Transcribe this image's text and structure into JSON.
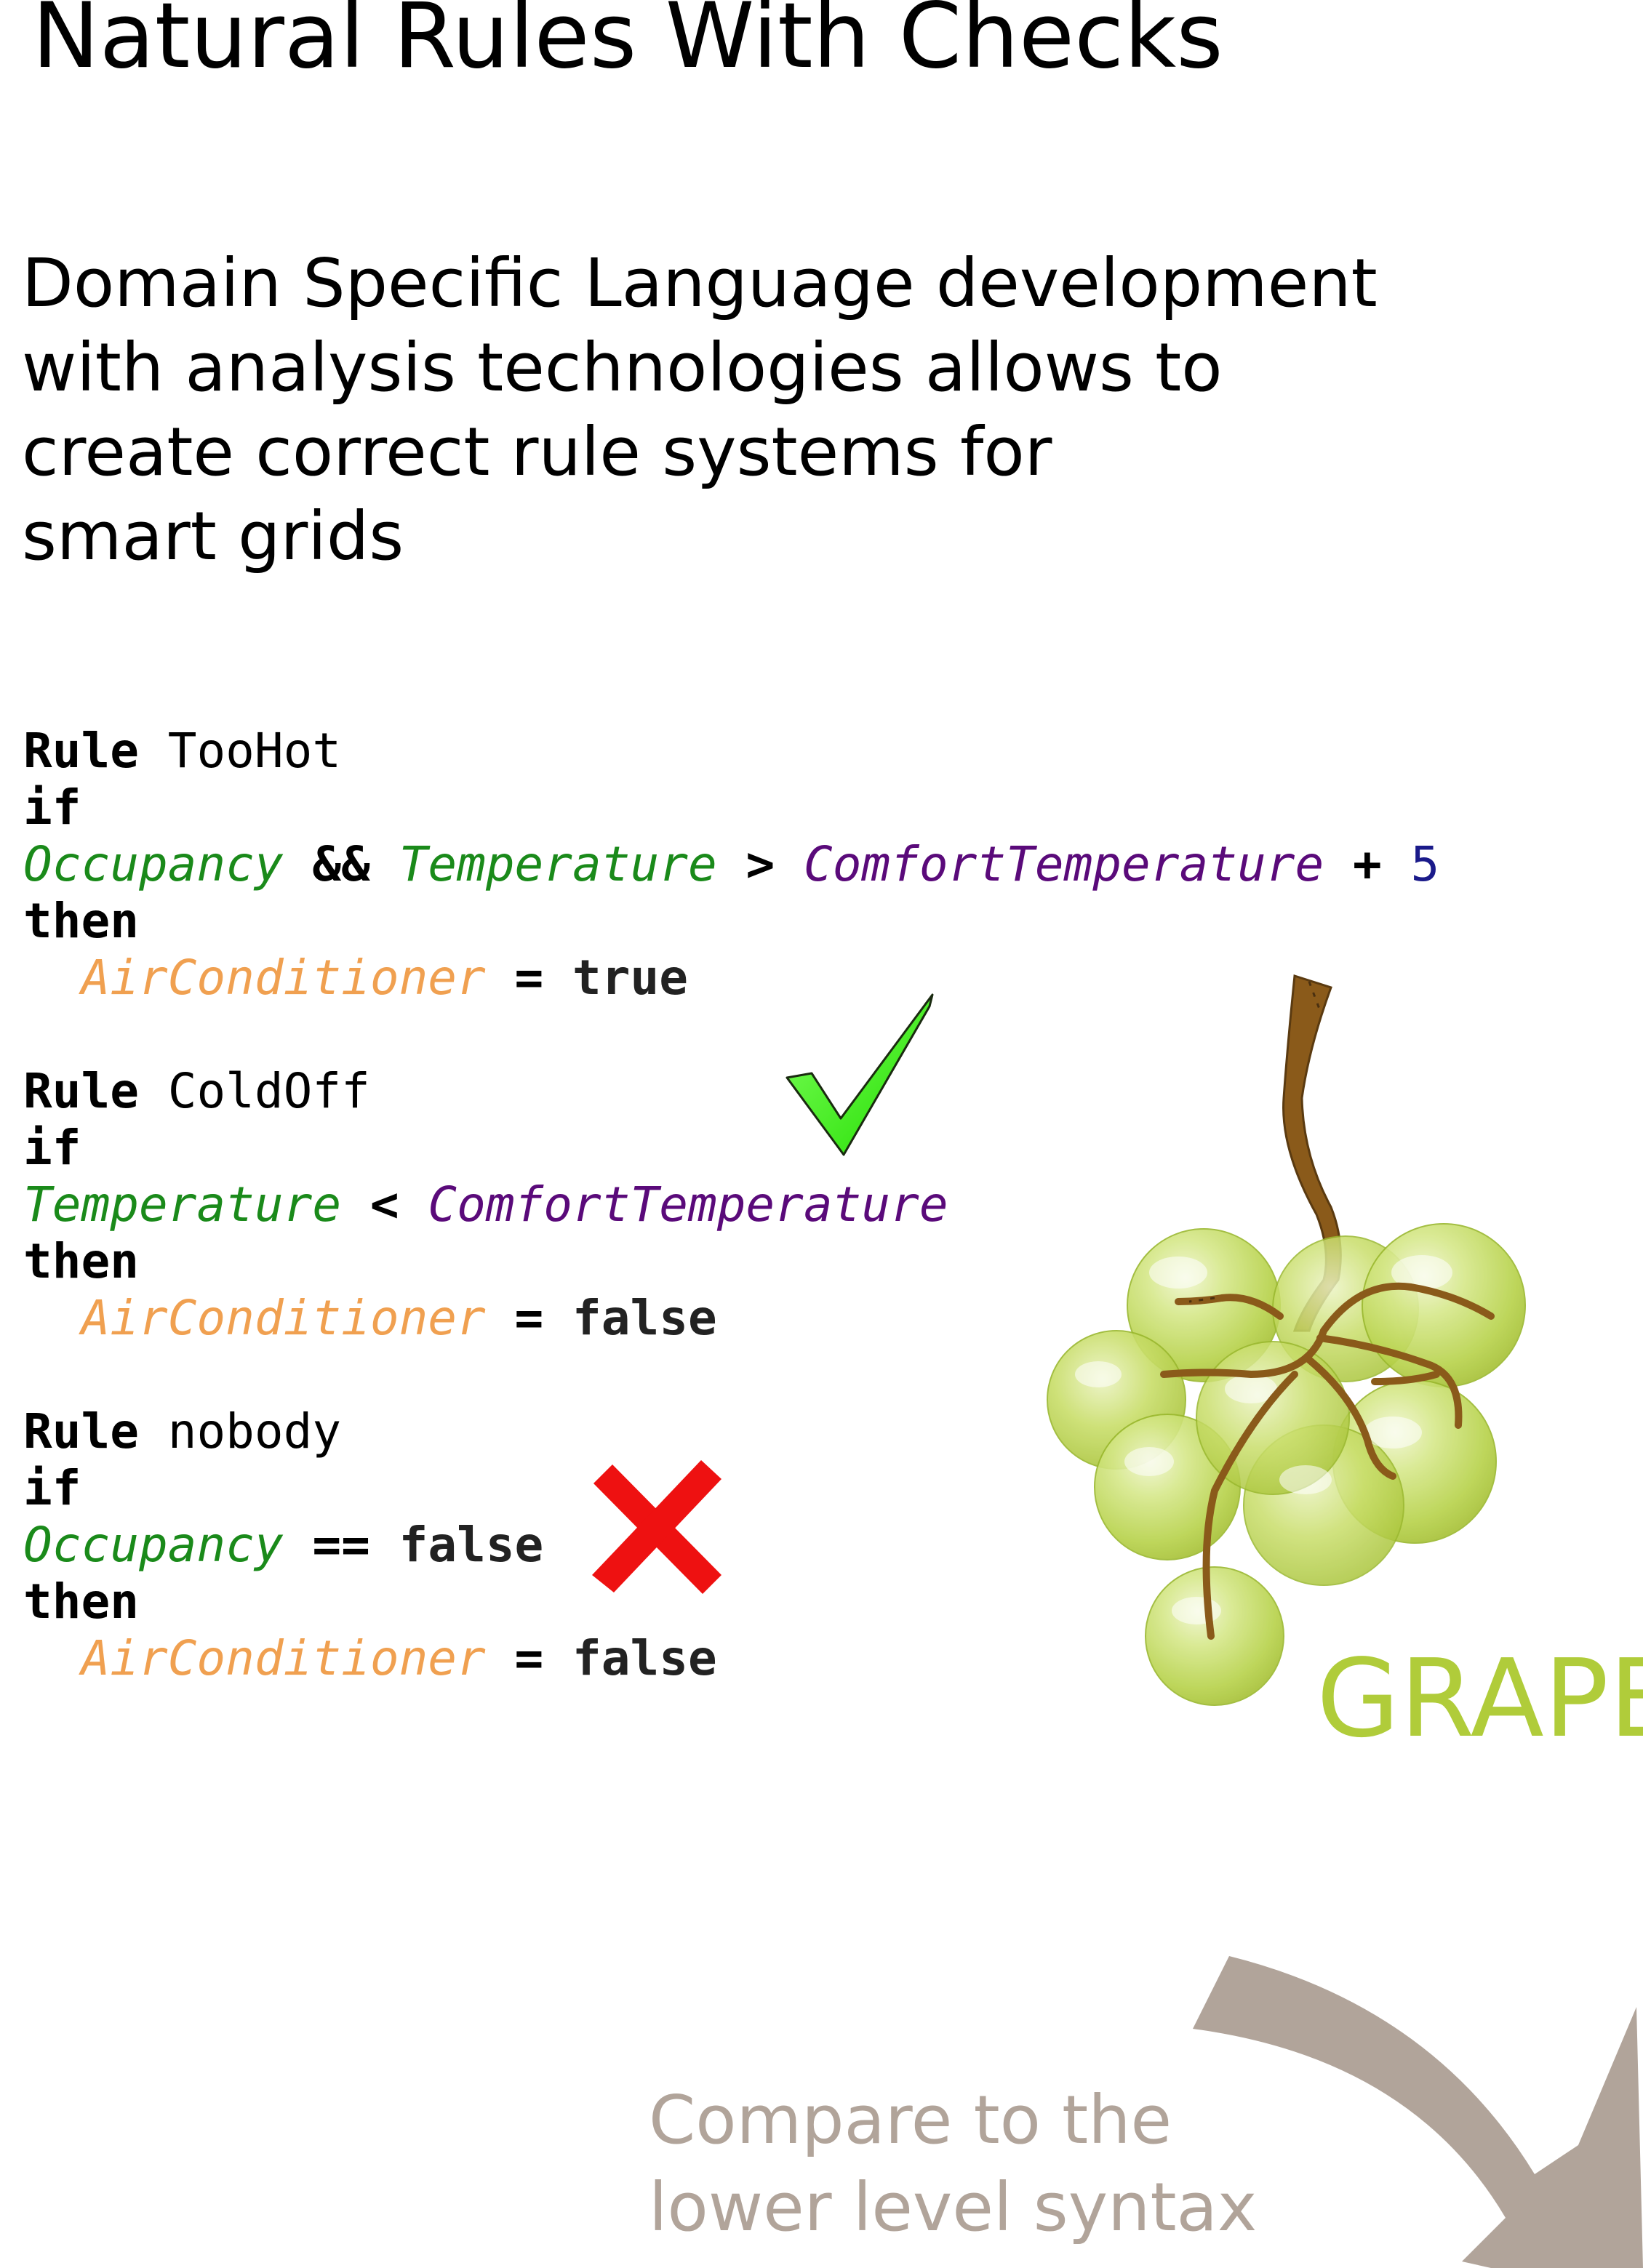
{
  "title": "Natural Rules With Checks",
  "intro_lines": [
    "Domain Specific Language development",
    "with analysis technologies allows to",
    "create correct rule systems for",
    "smart grids"
  ],
  "rules": [
    {
      "keyword": "Rule",
      "name": "TooHot",
      "if_kw": "if",
      "cond": {
        "a": "Occupancy",
        "and_op": "&&",
        "b": "Temperature",
        "gt": ">",
        "c": "ComfortTemperature",
        "plus": "+",
        "n": "5"
      },
      "then_kw": "then",
      "target": "AirConditioner",
      "eq": "=",
      "value": "true"
    },
    {
      "keyword": "Rule",
      "name": "ColdOff",
      "if_kw": "if",
      "cond": {
        "a": "Temperature",
        "lt": "<",
        "b": "ComfortTemperature"
      },
      "then_kw": "then",
      "target": "AirConditioner",
      "eq": "=",
      "value": "false"
    },
    {
      "keyword": "Rule",
      "name": "nobody",
      "if_kw": "if",
      "cond": {
        "a": "Occupancy",
        "eqeq": "==",
        "b": "false"
      },
      "then_kw": "then",
      "target": "AirConditioner",
      "eq": "=",
      "value": "false"
    }
  ],
  "grape_label": "GRAPE",
  "compare_lines": [
    "Compare to the",
    "lower level syntax"
  ],
  "colors": {
    "keyword": "#000000",
    "variable_green": "#1a8a1a",
    "variable_purple": "#5a0a7a",
    "variable_orange": "#f0a050",
    "number": "#1a1a8a",
    "check": "#33ee11",
    "cross": "#ee1111",
    "grape": "#b0cc3a",
    "stem": "#8a5a1a",
    "arrow": "#b1a49a"
  },
  "icons": [
    "checkmark-icon",
    "cross-icon",
    "grape-icon",
    "curved-arrow-icon"
  ]
}
